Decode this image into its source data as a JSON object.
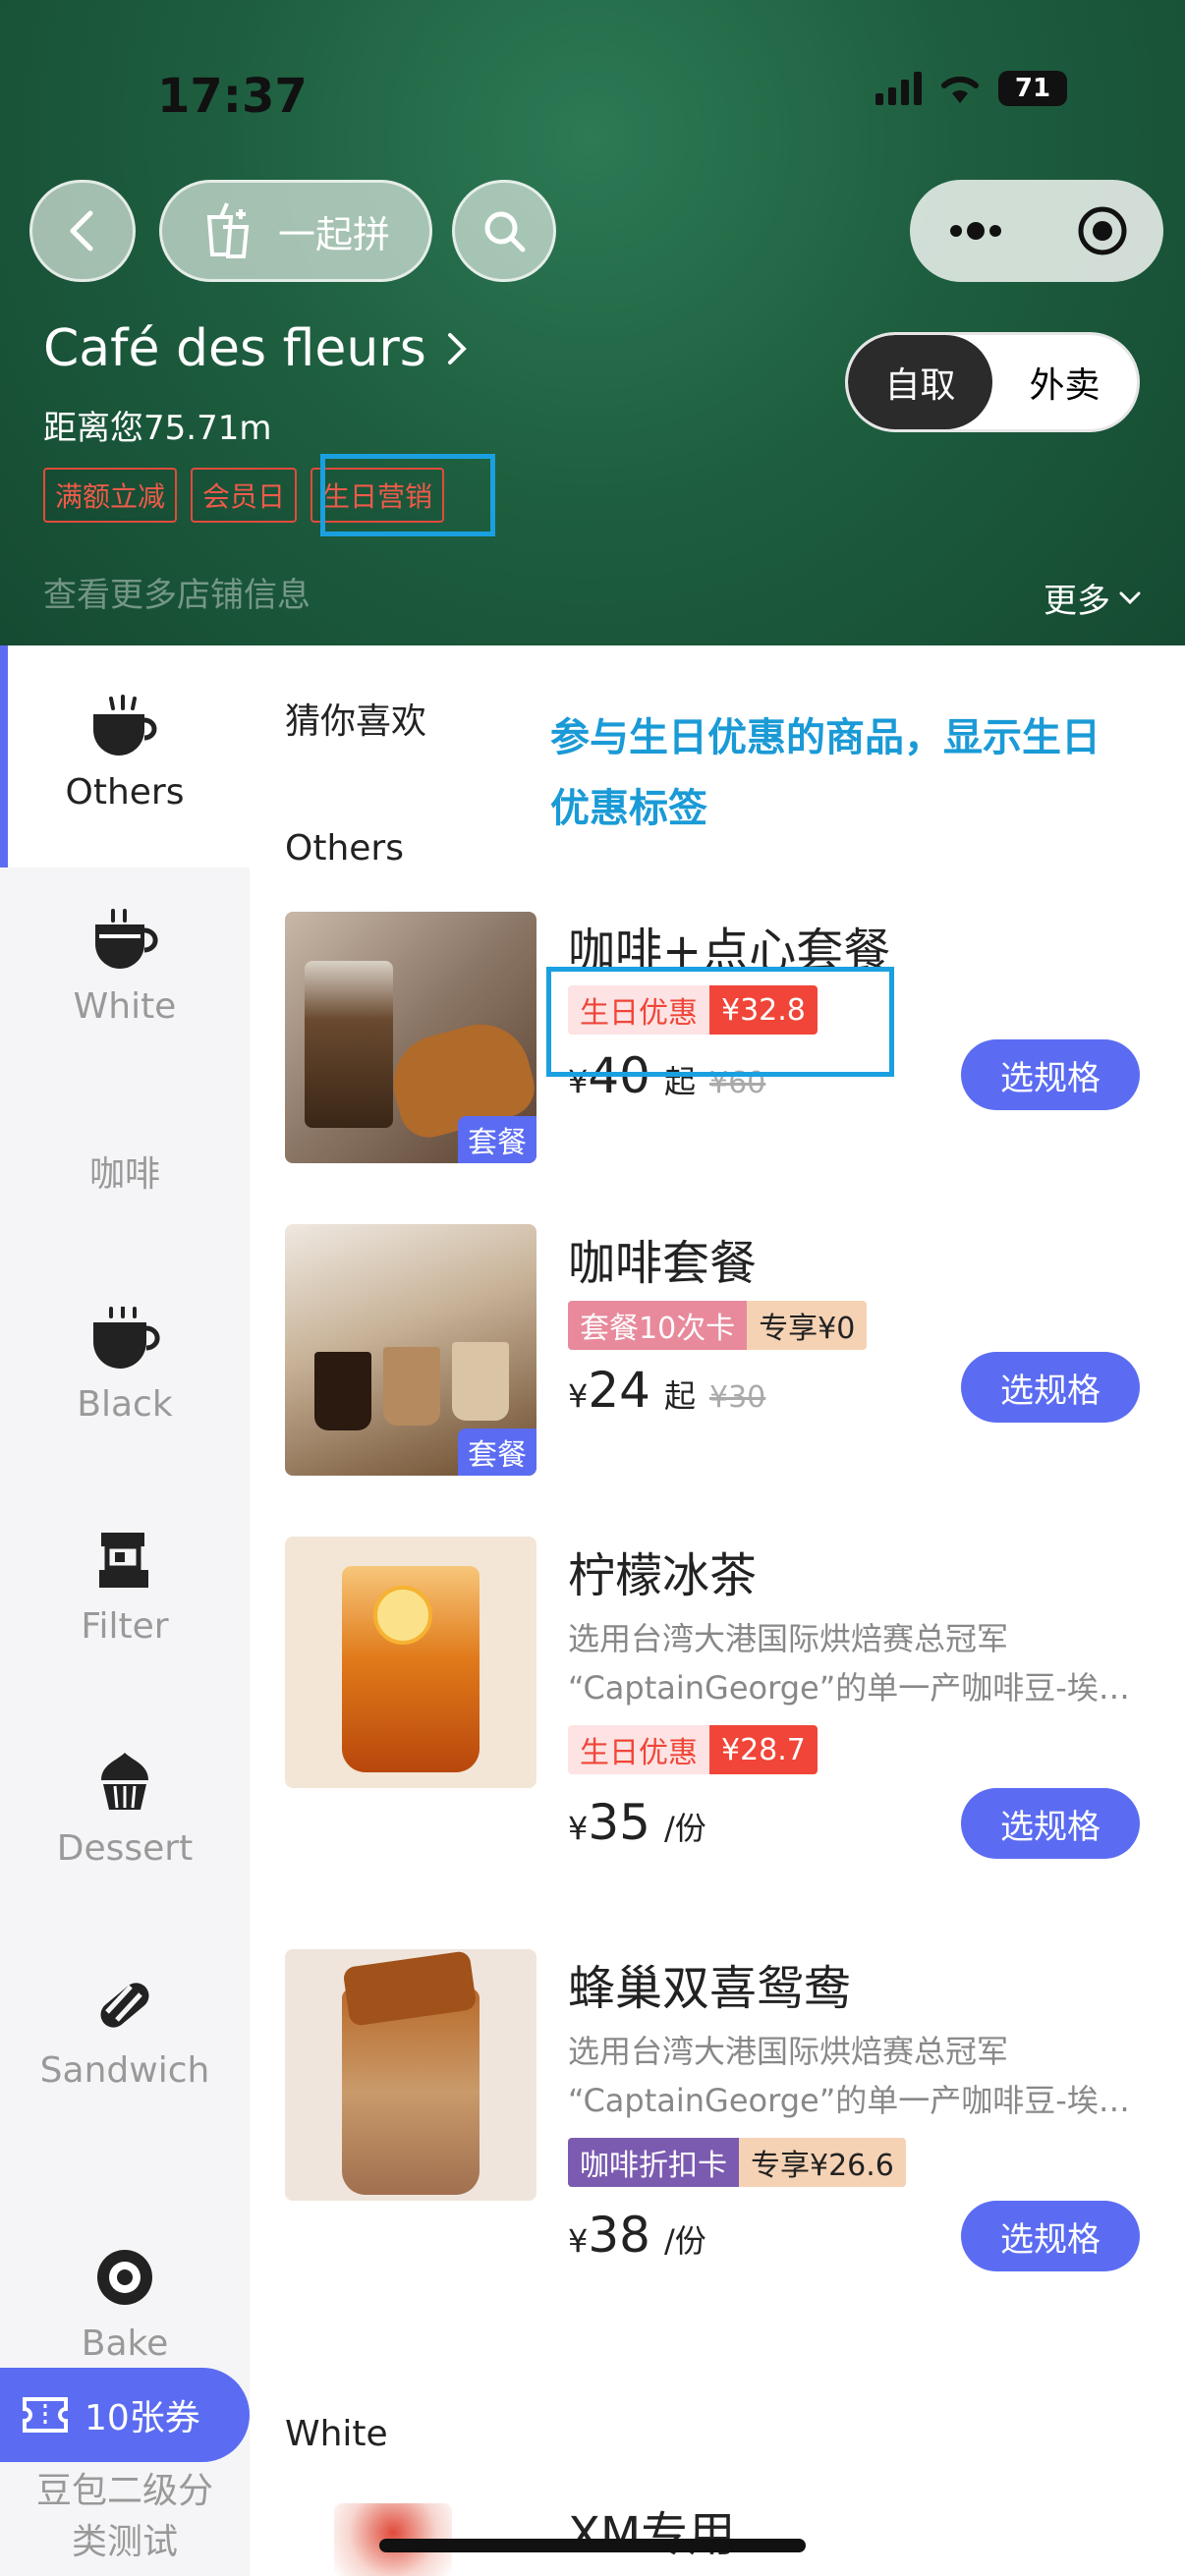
{
  "status_bar": {
    "time": "17:37",
    "battery": "71"
  },
  "header": {
    "pin_label": "一起拼",
    "store_name": "Café des fleurs",
    "distance": "距离您75.71m",
    "tags": [
      "满额立减",
      "会员日",
      "生日营销"
    ],
    "more_info": "查看更多店铺信息",
    "more_label": "更多",
    "mode_options": [
      "自取",
      "外卖"
    ],
    "mode_selected": "自取"
  },
  "sidebar": {
    "items": [
      {
        "label": "Others",
        "icon": "coffee-cup-icon",
        "active": true
      },
      {
        "label": "White",
        "icon": "latte-cup-icon"
      },
      {
        "label": "咖啡"
      },
      {
        "label": "Black",
        "icon": "black-coffee-icon"
      },
      {
        "label": "Filter",
        "icon": "filter-coffee-icon"
      },
      {
        "label": "Dessert",
        "icon": "cupcake-icon"
      },
      {
        "label": "Sandwich",
        "icon": "sandwich-icon"
      },
      {
        "label": "Bake",
        "icon": "donut-icon"
      },
      {
        "label": "豆包二级分类测试"
      }
    ],
    "coupon_label": "10张券"
  },
  "main": {
    "section_guess": "猜你喜欢",
    "annotation": "参与生日优惠的商品，显示生日优惠标签",
    "section_others": "Others",
    "section_white": "White",
    "products": [
      {
        "title": "咖啡+点心套餐",
        "image_badge": "套餐",
        "badge_left": "生日优惠",
        "badge_right": "¥32.8",
        "price_yen": "¥",
        "price": "40",
        "unit": "起",
        "original": "¥60",
        "button": "选规格"
      },
      {
        "title": "咖啡套餐",
        "image_badge": "套餐",
        "badge_left": "套餐10次卡",
        "badge_right": "专享¥0",
        "price_yen": "¥",
        "price": "24",
        "unit": "起",
        "original": "¥30",
        "button": "选规格"
      },
      {
        "title": "柠檬冰茶",
        "desc1": "选用台湾大港国际烘焙赛总冠军",
        "desc2": "“CaptainGeorge”的单一产咖啡豆-埃塞俄比亚",
        "badge_left": "生日优惠",
        "badge_right": "¥28.7",
        "price_yen": "¥",
        "price": "35",
        "unit": "/份",
        "button": "选规格"
      },
      {
        "title": "蜂巢双喜鸳鸯",
        "desc1": "选用台湾大港国际烘焙赛总冠军",
        "desc2": "“CaptainGeorge”的单一产咖啡豆-埃塞俄比亚",
        "badge_left": "咖啡折扣卡",
        "badge_right": "专享¥26.6",
        "price_yen": "¥",
        "price": "38",
        "unit": "/份",
        "button": "选规格"
      }
    ],
    "next_product_title": "XM专用"
  },
  "colors": {
    "accent": "#5b6cf2",
    "header_green": "#1e5f40",
    "birthday_red": "#f04538",
    "annotation_blue": "#1a9ad6"
  }
}
